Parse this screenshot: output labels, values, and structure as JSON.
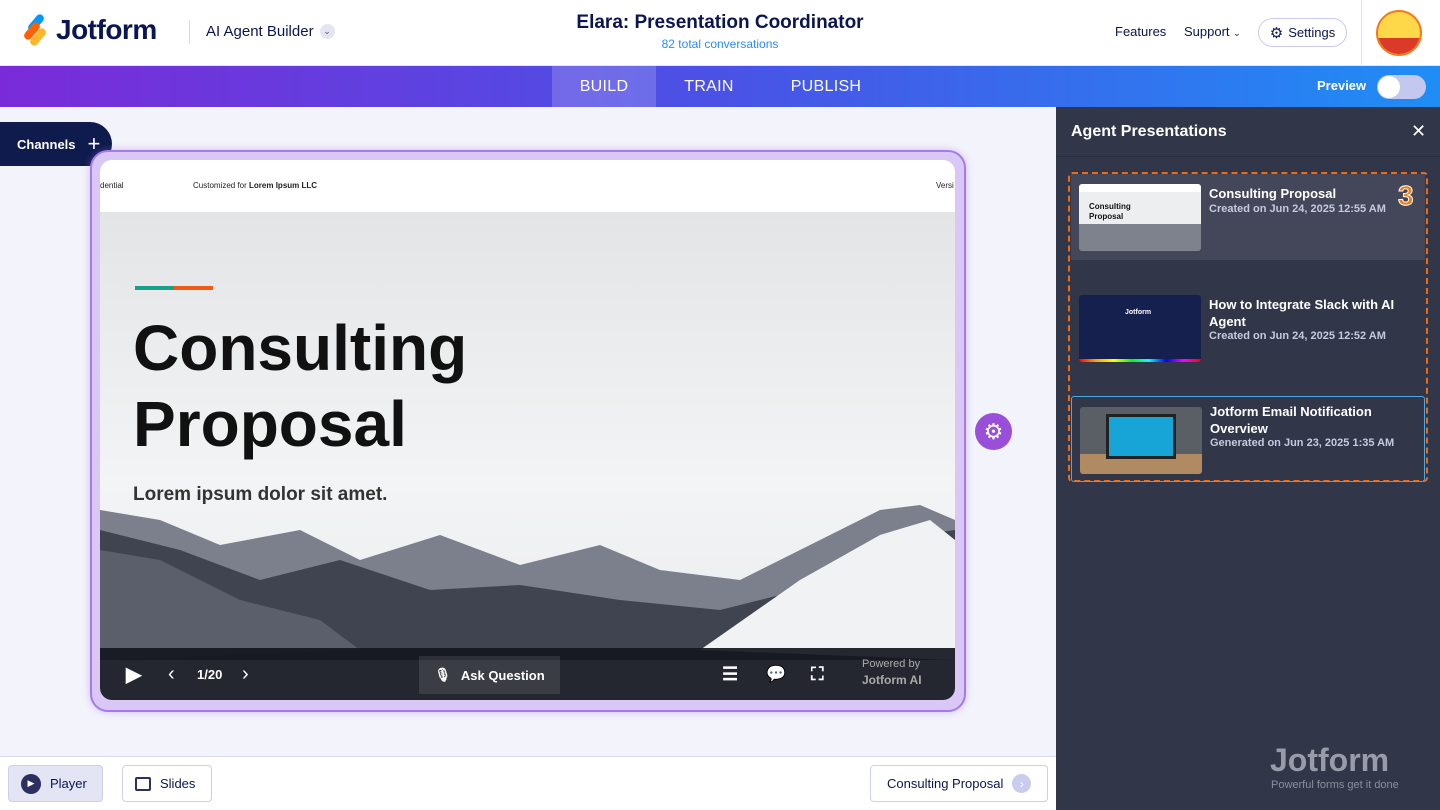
{
  "header": {
    "brand": "Jotform",
    "product": "AI Agent Builder",
    "title": "Elara: Presentation Coordinator",
    "subtitle": "82 total conversations",
    "links": [
      "Features",
      "Support"
    ],
    "settings": "Settings"
  },
  "nav": {
    "tabs": [
      "BUILD",
      "TRAIN",
      "PUBLISH"
    ],
    "active": "BUILD",
    "preview_label": "Preview",
    "preview_on": false
  },
  "channels": {
    "label": "Channels"
  },
  "slide": {
    "head_left": "dential",
    "head_customized": "Customized for",
    "head_client": "Lorem Ipsum LLC",
    "head_right": "Versi",
    "title_line1": "Consulting",
    "title_line2": "Proposal",
    "subtitle": "Lorem ipsum dolor sit amet.",
    "page": "1/20",
    "ask": "Ask Question",
    "powered_by": "Powered by",
    "powered_brand": "Jotform AI"
  },
  "bottom": {
    "player": "Player",
    "slides": "Slides",
    "current": "Consulting Proposal"
  },
  "panel": {
    "title": "Agent Presentations",
    "badge": "3",
    "items": [
      {
        "name": "Consulting Proposal",
        "date": "Created on Jun 24, 2025 12:55 AM",
        "thumb_title": "Consulting Proposal"
      },
      {
        "name": "How to Integrate Slack with AI Agent",
        "date": "Created on Jun 24, 2025 12:52 AM",
        "thumb_title": "Jotform"
      },
      {
        "name": "Jotform Email Notification Overview",
        "date": "Generated on Jun 23, 2025 1:35 AM"
      }
    ]
  },
  "watermark": {
    "brand": "Jotform",
    "tagline": "Powerful forms get it done"
  }
}
